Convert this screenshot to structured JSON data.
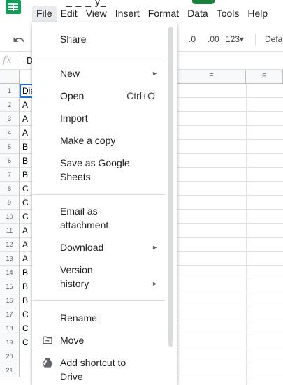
{
  "title_fragment": "_ _ _ y_",
  "menubar": {
    "items": [
      {
        "label": "File"
      },
      {
        "label": "Edit"
      },
      {
        "label": "View"
      },
      {
        "label": "Insert"
      },
      {
        "label": "Format"
      },
      {
        "label": "Data"
      },
      {
        "label": "Tools"
      },
      {
        "label": "Help"
      }
    ]
  },
  "toolbar": {
    "decrease_decimal": ".0",
    "increase_decimal": ".00",
    "number_format": "123▾",
    "font_fragment": "Defa"
  },
  "formula_bar": {
    "fx_label": "fx",
    "cell_fragment": "D"
  },
  "grid": {
    "columns": [
      "E",
      "F"
    ],
    "rows": [
      "1",
      "2",
      "3",
      "4",
      "5",
      "6",
      "7",
      "8",
      "9",
      "10",
      "11",
      "12",
      "13",
      "14",
      "15",
      "16",
      "17",
      "18",
      "19",
      "20",
      "21"
    ],
    "cells": [
      "Die",
      "A",
      "A",
      "A",
      "B",
      "B",
      "B",
      "C",
      "C",
      "C",
      "A",
      "A",
      "A",
      "B",
      "B",
      "B",
      "C",
      "C",
      "C",
      "",
      ""
    ]
  },
  "file_menu": {
    "share": "Share",
    "new": "New",
    "open": "Open",
    "open_shortcut": "Ctrl+O",
    "import": "Import",
    "make_copy": "Make a copy",
    "save_as_sheets": "Save as Google\nSheets",
    "email": "Email as\nattachment",
    "download": "Download",
    "version_history": "Version\nhistory",
    "rename": "Rename",
    "move": "Move",
    "add_shortcut": "Add shortcut to\nDrive",
    "submenu_arrow": "►"
  },
  "colors": {
    "brand_green": "#0f9d58",
    "selection_blue": "#1a73e8",
    "menu_active_bg": "#e8eaed"
  }
}
